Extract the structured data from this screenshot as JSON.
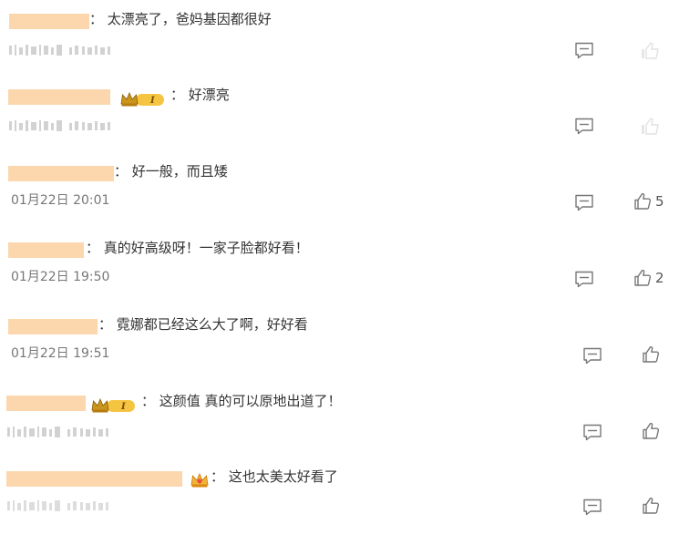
{
  "comments": [
    {
      "text": "： 太漂亮了，爸妈基因都很好",
      "timestamp": "",
      "likes": ""
    },
    {
      "text": "： 好漂亮",
      "timestamp": "",
      "likes": ""
    },
    {
      "text": "： 好一般，而且矮",
      "timestamp": "01月22日 20:01",
      "likes": "5"
    },
    {
      "text": "： 真的好高级呀！一家子脸都好看！",
      "timestamp": "01月22日 19:50",
      "likes": "2"
    },
    {
      "text": "： 霓娜都已经这么大了啊，好好看",
      "timestamp": "01月22日 19:51",
      "likes": ""
    },
    {
      "text": "： 这颜值 真的可以原地出道了！",
      "timestamp": "",
      "likes": ""
    },
    {
      "text": "： 这也太美太好看了",
      "timestamp": "",
      "likes": ""
    }
  ],
  "badges": {
    "vip_level": "I"
  },
  "icons": {
    "comment": "comment-icon",
    "like": "thumbs-up-icon"
  },
  "colors": {
    "name_mask": "#fcd7ad",
    "icon": "#777777",
    "crown": "#c9951c",
    "badge": "#f5c542"
  }
}
